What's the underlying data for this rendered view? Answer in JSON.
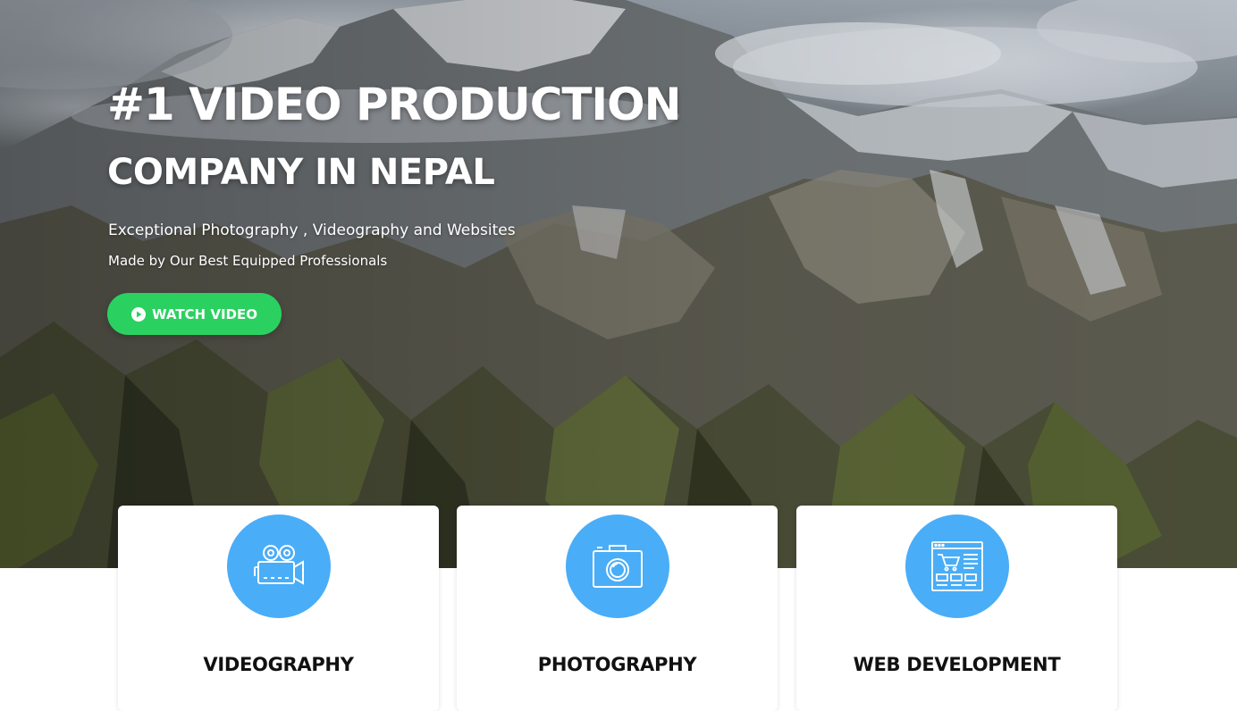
{
  "hero": {
    "headline_line1": "#1 VIDEO PRODUCTION",
    "headline_line2": "COMPANY IN NEPAL",
    "subheadline_line1": "Exceptional Photography , Videography and Websites",
    "subheadline_line2": "Made by Our Best Equipped Professionals",
    "watch_button_label": "WATCH VIDEO",
    "background_image": "snow-capped-mountains"
  },
  "services": [
    {
      "title": "VIDEOGRAPHY",
      "icon": "video-camera-icon"
    },
    {
      "title": "PHOTOGRAPHY",
      "icon": "photo-camera-icon"
    },
    {
      "title": "WEB DEVELOPMENT",
      "icon": "web-store-icon"
    }
  ],
  "colors": {
    "button_green": "#2bd160",
    "icon_circle_blue": "#4aadf7",
    "text_white": "#ffffff",
    "card_title": "#111111"
  }
}
